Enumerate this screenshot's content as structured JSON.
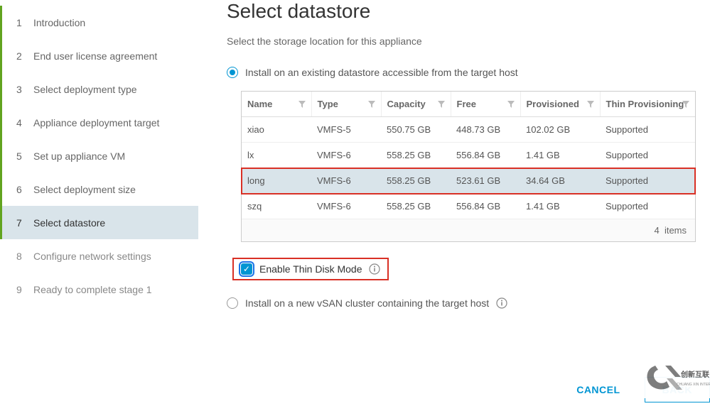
{
  "sidebar": {
    "steps": [
      {
        "num": "1",
        "label": "Introduction",
        "state": "done"
      },
      {
        "num": "2",
        "label": "End user license agreement",
        "state": "done"
      },
      {
        "num": "3",
        "label": "Select deployment type",
        "state": "done"
      },
      {
        "num": "4",
        "label": "Appliance deployment target",
        "state": "done"
      },
      {
        "num": "5",
        "label": "Set up appliance VM",
        "state": "done"
      },
      {
        "num": "6",
        "label": "Select deployment size",
        "state": "done"
      },
      {
        "num": "7",
        "label": "Select datastore",
        "state": "active"
      },
      {
        "num": "8",
        "label": "Configure network settings",
        "state": "todo"
      },
      {
        "num": "9",
        "label": "Ready to complete stage 1",
        "state": "todo"
      }
    ]
  },
  "main": {
    "title": "Select datastore",
    "subtitle": "Select the storage location for this appliance",
    "install_existing_label": "Install on an existing datastore accessible from the target host",
    "thin_disk_label": "Enable Thin Disk Mode",
    "install_vsan_label": "Install on a new vSAN cluster containing the target host"
  },
  "table": {
    "headers": {
      "name": "Name",
      "type": "Type",
      "capacity": "Capacity",
      "free": "Free",
      "provisioned": "Provisioned",
      "thin": "Thin Provisioning"
    },
    "rows": [
      {
        "name": "xiao",
        "type": "VMFS-5",
        "capacity": "550.75 GB",
        "free": "448.73 GB",
        "provisioned": "102.02 GB",
        "thin": "Supported",
        "selected": false,
        "highlight": false
      },
      {
        "name": "lx",
        "type": "VMFS-6",
        "capacity": "558.25 GB",
        "free": "556.84 GB",
        "provisioned": "1.41 GB",
        "thin": "Supported",
        "selected": false,
        "highlight": false
      },
      {
        "name": "long",
        "type": "VMFS-6",
        "capacity": "558.25 GB",
        "free": "523.61 GB",
        "provisioned": "34.64 GB",
        "thin": "Supported",
        "selected": true,
        "highlight": true
      },
      {
        "name": "szq",
        "type": "VMFS-6",
        "capacity": "558.25 GB",
        "free": "556.84 GB",
        "provisioned": "1.41 GB",
        "thin": "Supported",
        "selected": false,
        "highlight": false
      }
    ],
    "footer_count": "4",
    "footer_label": "items"
  },
  "actions": {
    "cancel": "CANCEL",
    "back": "BACK"
  },
  "watermark": {
    "brand_cn": "创新互联",
    "brand_en": "CHUANG XIN INTERNET"
  }
}
